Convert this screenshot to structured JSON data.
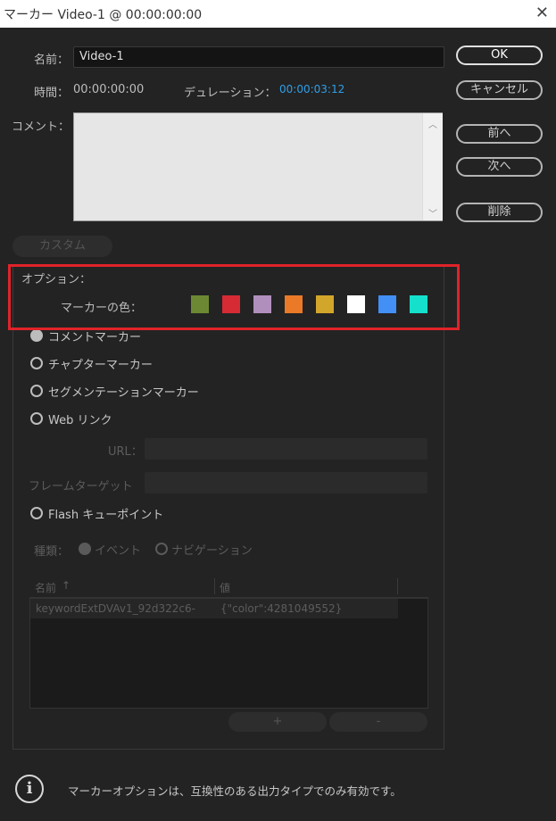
{
  "window": {
    "title": "マーカー Video-1 @ 00:00:00:00",
    "close_glyph": "✕"
  },
  "form": {
    "name_label": "名前：",
    "name_value": "Video-1",
    "time_label": "時間：",
    "time_value": "00:00:00:00",
    "duration_label": "デュレーション：",
    "duration_value": "00:00:03:12",
    "comment_label": "コメント：",
    "comment_value": ""
  },
  "buttons": {
    "ok": "OK",
    "cancel": "キャンセル",
    "prev": "前へ",
    "next": "次へ",
    "delete": "削除"
  },
  "custom_tab": "カスタム",
  "options": {
    "heading": "オプション：",
    "marker_color_label": "マーカーの色：",
    "colors": [
      "#6d8833",
      "#d62b35",
      "#b18fbd",
      "#ea7a27",
      "#d2a62a",
      "#ffffff",
      "#428ff5",
      "#14e0cc"
    ],
    "marker_types": {
      "comment": "コメントマーカー",
      "chapter": "チャプターマーカー",
      "segmentation": "セグメンテーションマーカー",
      "weblink": "Web リンク",
      "flash": "Flash キューポイント"
    },
    "url_label": "URL：",
    "frame_target_label": "フレームターゲット",
    "type_label": "種類：",
    "event_label": "イベント",
    "navigation_label": "ナビゲーション"
  },
  "table": {
    "col_name": "名前",
    "sort_glyph": "↑",
    "col_value": "値",
    "rows": [
      {
        "name": "keywordExtDVAv1_92d322c6-",
        "value": "{\"color\":4281049552}"
      }
    ],
    "add": "+",
    "remove": "-"
  },
  "footer": {
    "info_glyph": "i",
    "text": "マーカーオプションは、互換性のある出力タイプでのみ有効です。"
  }
}
